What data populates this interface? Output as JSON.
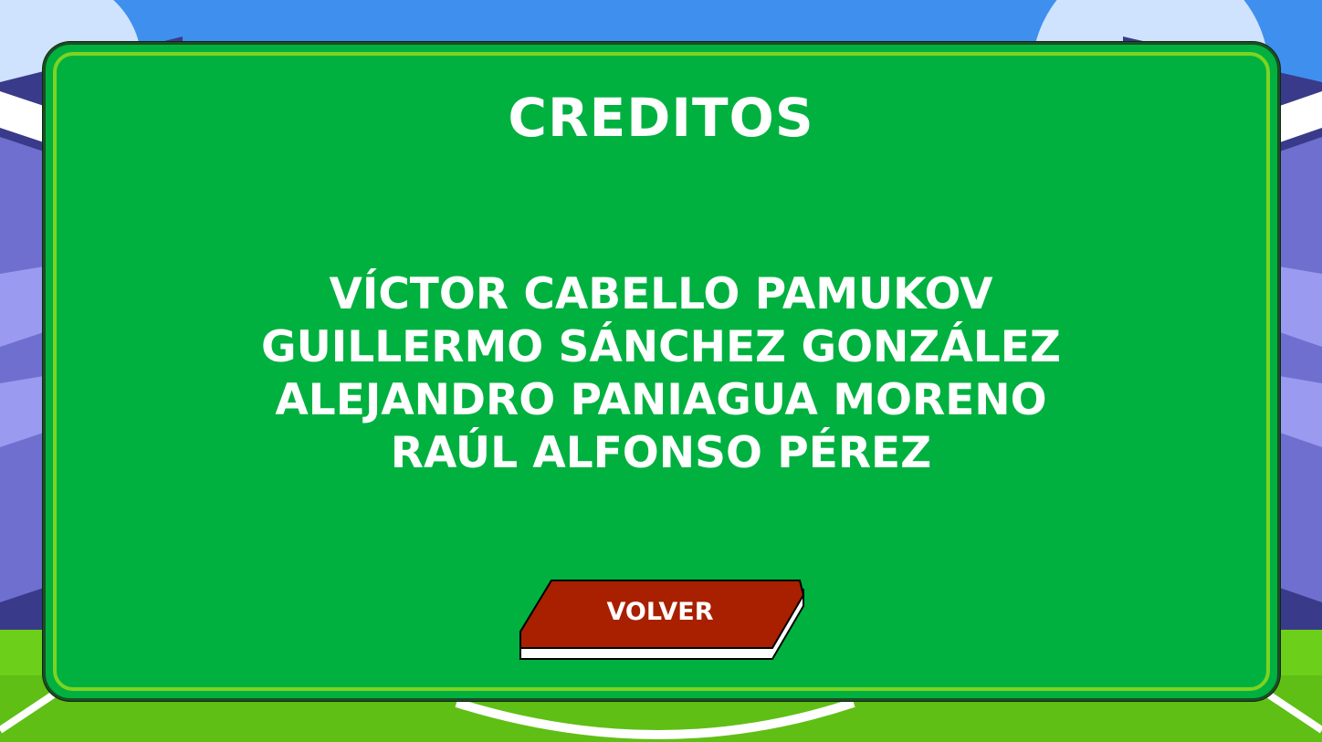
{
  "screen": "credits",
  "title": "CREDITOS",
  "credits": [
    "VÍCTOR CABELLO PAMUKOV",
    "GUILLERMO SÁNCHEZ GONZÁLEZ",
    "ALEJANDRO PANIAGUA MORENO",
    "RAÚL ALFONSO PÉREZ"
  ],
  "back_button": {
    "label": "VOLVER"
  },
  "colors": {
    "panel": "#00b140",
    "panel_border": "#7ed321",
    "button": "#a82000",
    "sky": "#3f8fef",
    "pitch": "#6ccf1a",
    "stands": "#4a4aa0"
  }
}
